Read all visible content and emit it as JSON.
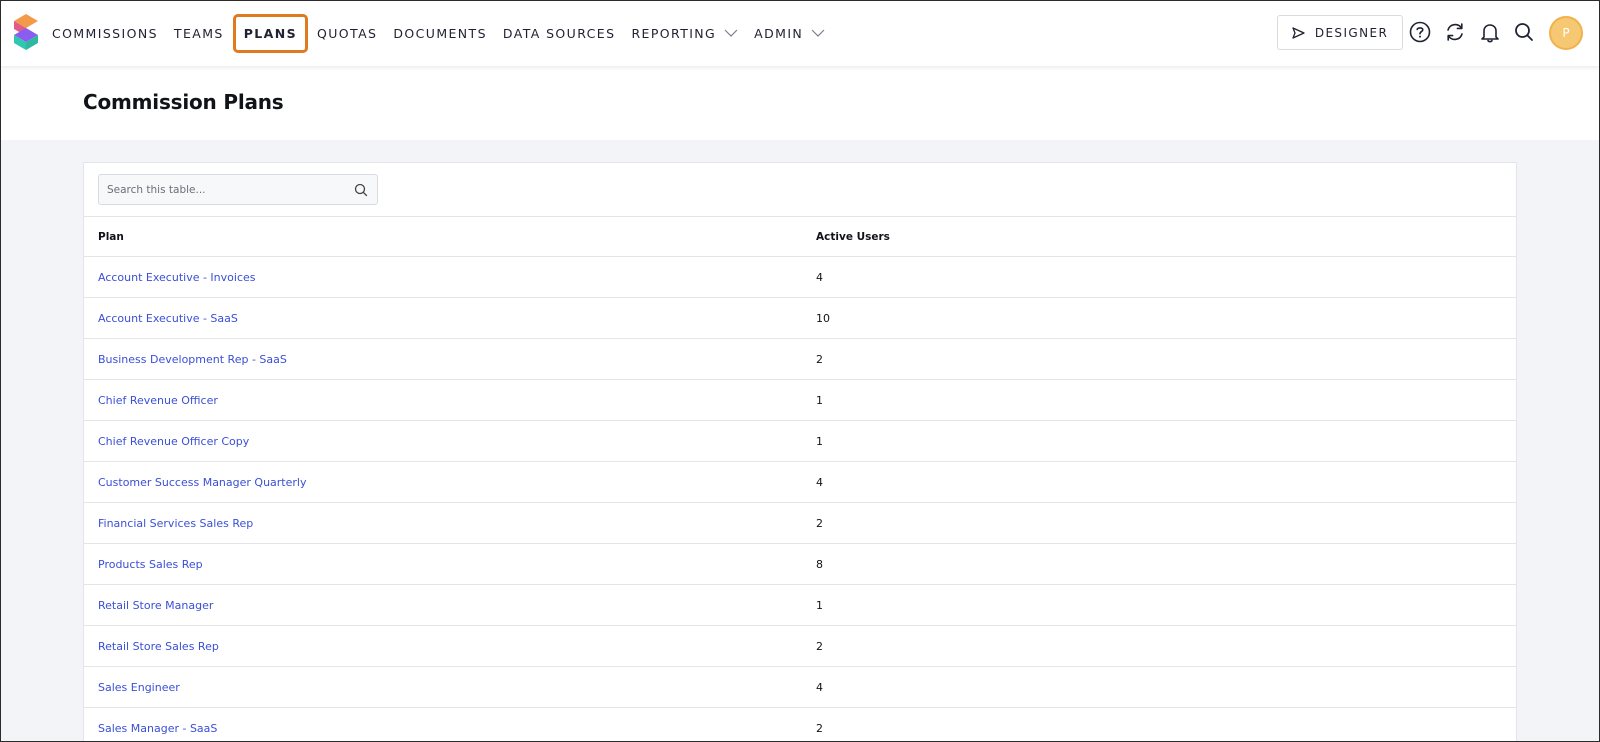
{
  "nav": {
    "items": [
      {
        "label": "COMMISSIONS",
        "active": false,
        "dropdown": false
      },
      {
        "label": "TEAMS",
        "active": false,
        "dropdown": false
      },
      {
        "label": "PLANS",
        "active": true,
        "dropdown": false
      },
      {
        "label": "QUOTAS",
        "active": false,
        "dropdown": false
      },
      {
        "label": "DOCUMENTS",
        "active": false,
        "dropdown": false
      },
      {
        "label": "DATA SOURCES",
        "active": false,
        "dropdown": false
      },
      {
        "label": "REPORTING",
        "active": false,
        "dropdown": true
      },
      {
        "label": "ADMIN",
        "active": false,
        "dropdown": true
      }
    ],
    "designer_label": "DESIGNER",
    "avatar_initial": "P",
    "icons": [
      "help-icon",
      "refresh-icon",
      "bell-icon",
      "search-icon"
    ]
  },
  "page": {
    "title": "Commission Plans"
  },
  "table": {
    "search_placeholder": "Search this table...",
    "columns": [
      "Plan",
      "Active Users"
    ],
    "rows": [
      {
        "plan": "Account Executive - Invoices",
        "users": "4"
      },
      {
        "plan": "Account Executive - SaaS",
        "users": "10"
      },
      {
        "plan": "Business Development Rep - SaaS",
        "users": "2"
      },
      {
        "plan": "Chief Revenue Officer",
        "users": "1"
      },
      {
        "plan": "Chief Revenue Officer Copy",
        "users": "1"
      },
      {
        "plan": "Customer Success Manager Quarterly",
        "users": "4"
      },
      {
        "plan": "Financial Services Sales Rep",
        "users": "2"
      },
      {
        "plan": "Products Sales Rep",
        "users": "8"
      },
      {
        "plan": "Retail Store Manager",
        "users": "1"
      },
      {
        "plan": "Retail Store Sales Rep",
        "users": "2"
      },
      {
        "plan": "Sales Engineer",
        "users": "4"
      },
      {
        "plan": "Sales Manager - SaaS",
        "users": "2"
      }
    ]
  },
  "colors": {
    "link": "#3a4fd6",
    "active_outline": "#e07a1f",
    "avatar": "#f7c873"
  }
}
